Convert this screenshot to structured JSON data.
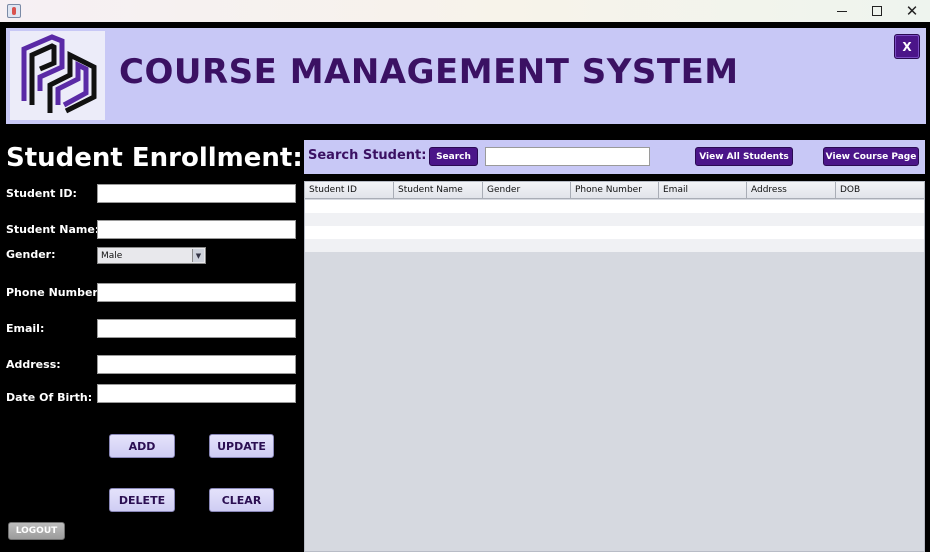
{
  "window": {
    "controls": [
      "minimize-icon",
      "maximize-icon",
      "close-icon"
    ],
    "close_glyph": "✕"
  },
  "header": {
    "title": "COURSE MANAGEMENT SYSTEM",
    "close_label": "X",
    "background": "#c8c8f6",
    "title_color": "#3b1163"
  },
  "form": {
    "title": "Student Enrollment:",
    "labels": {
      "student_id": "Student ID:",
      "student_name": "Student Name:",
      "gender": "Gender:",
      "phone": "Phone Number:",
      "email": "Email:",
      "address": "Address:",
      "dob": "Date Of Birth:"
    },
    "values": {
      "student_id": "",
      "student_name": "",
      "phone": "",
      "email": "",
      "address": "",
      "dob": ""
    },
    "gender_selected": "Male",
    "buttons": {
      "add": "ADD",
      "update": "UPDATE",
      "delete": "DELETE",
      "clear": "CLEAR",
      "logout": "LOGOUT"
    }
  },
  "search": {
    "label": "Search Student:",
    "search_button": "Search",
    "query": "",
    "view_all_button": "View  All Students",
    "view_course_button": "View Course Page"
  },
  "table": {
    "columns": [
      "Student ID",
      "Student Name",
      "Gender",
      "Phone Number",
      "Email",
      "Address",
      "DOB"
    ],
    "rows": []
  },
  "colors": {
    "accent": "#4b1589",
    "panel": "#000000",
    "table_bg": "#d6d9e0"
  }
}
